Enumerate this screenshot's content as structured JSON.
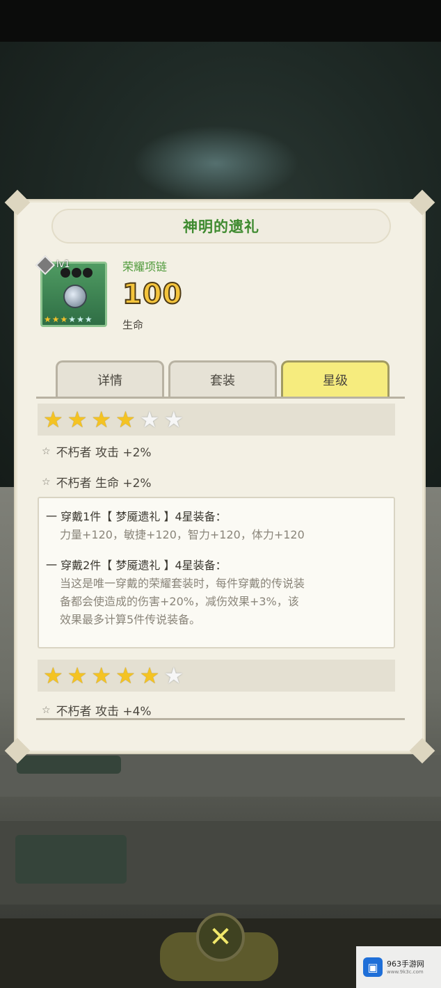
{
  "dialog": {
    "title": "神明的遗礼",
    "item": {
      "level": "lv1",
      "type": "荣耀项链",
      "value": "100",
      "stat": "生命",
      "icon_stars": {
        "gold": 3,
        "total": 6
      }
    },
    "tabs": [
      {
        "label": "详情",
        "active": false
      },
      {
        "label": "套装",
        "active": false
      },
      {
        "label": "星级",
        "active": true
      }
    ],
    "star_tiers": [
      {
        "stars_filled": 4,
        "stars_total": 6,
        "bonuses": [
          "不朽者 攻击 +2%",
          "不朽者 生命 +2%"
        ],
        "set_bonus": {
          "piece1_head": "一 穿戴1件【 梦魇遗礼 】4星装备：",
          "piece1_body": "力量+120，敏捷+120，智力+120，体力+120",
          "piece2_head": "一 穿戴2件【 梦魇遗礼 】4星装备：",
          "piece2_body_lines": [
            "当这是唯一穿戴的荣耀套装时，每件穿戴的传说装",
            "备都会使造成的伤害+20%，减伤效果+3%，该",
            "效果最多计算5件传说装备。"
          ]
        }
      },
      {
        "stars_filled": 5,
        "stars_total": 6,
        "bonuses": [
          "不朽者 攻击 +4%"
        ]
      }
    ]
  },
  "close_button": {
    "icon": "close-x-icon",
    "glyph": "✕"
  },
  "watermark": {
    "name": "963手游网",
    "url": "www.9k3c.com"
  },
  "colors": {
    "title_green": "#3e8a2f",
    "active_tab": "#f6ec7e",
    "star_gold": "#f4c323"
  }
}
